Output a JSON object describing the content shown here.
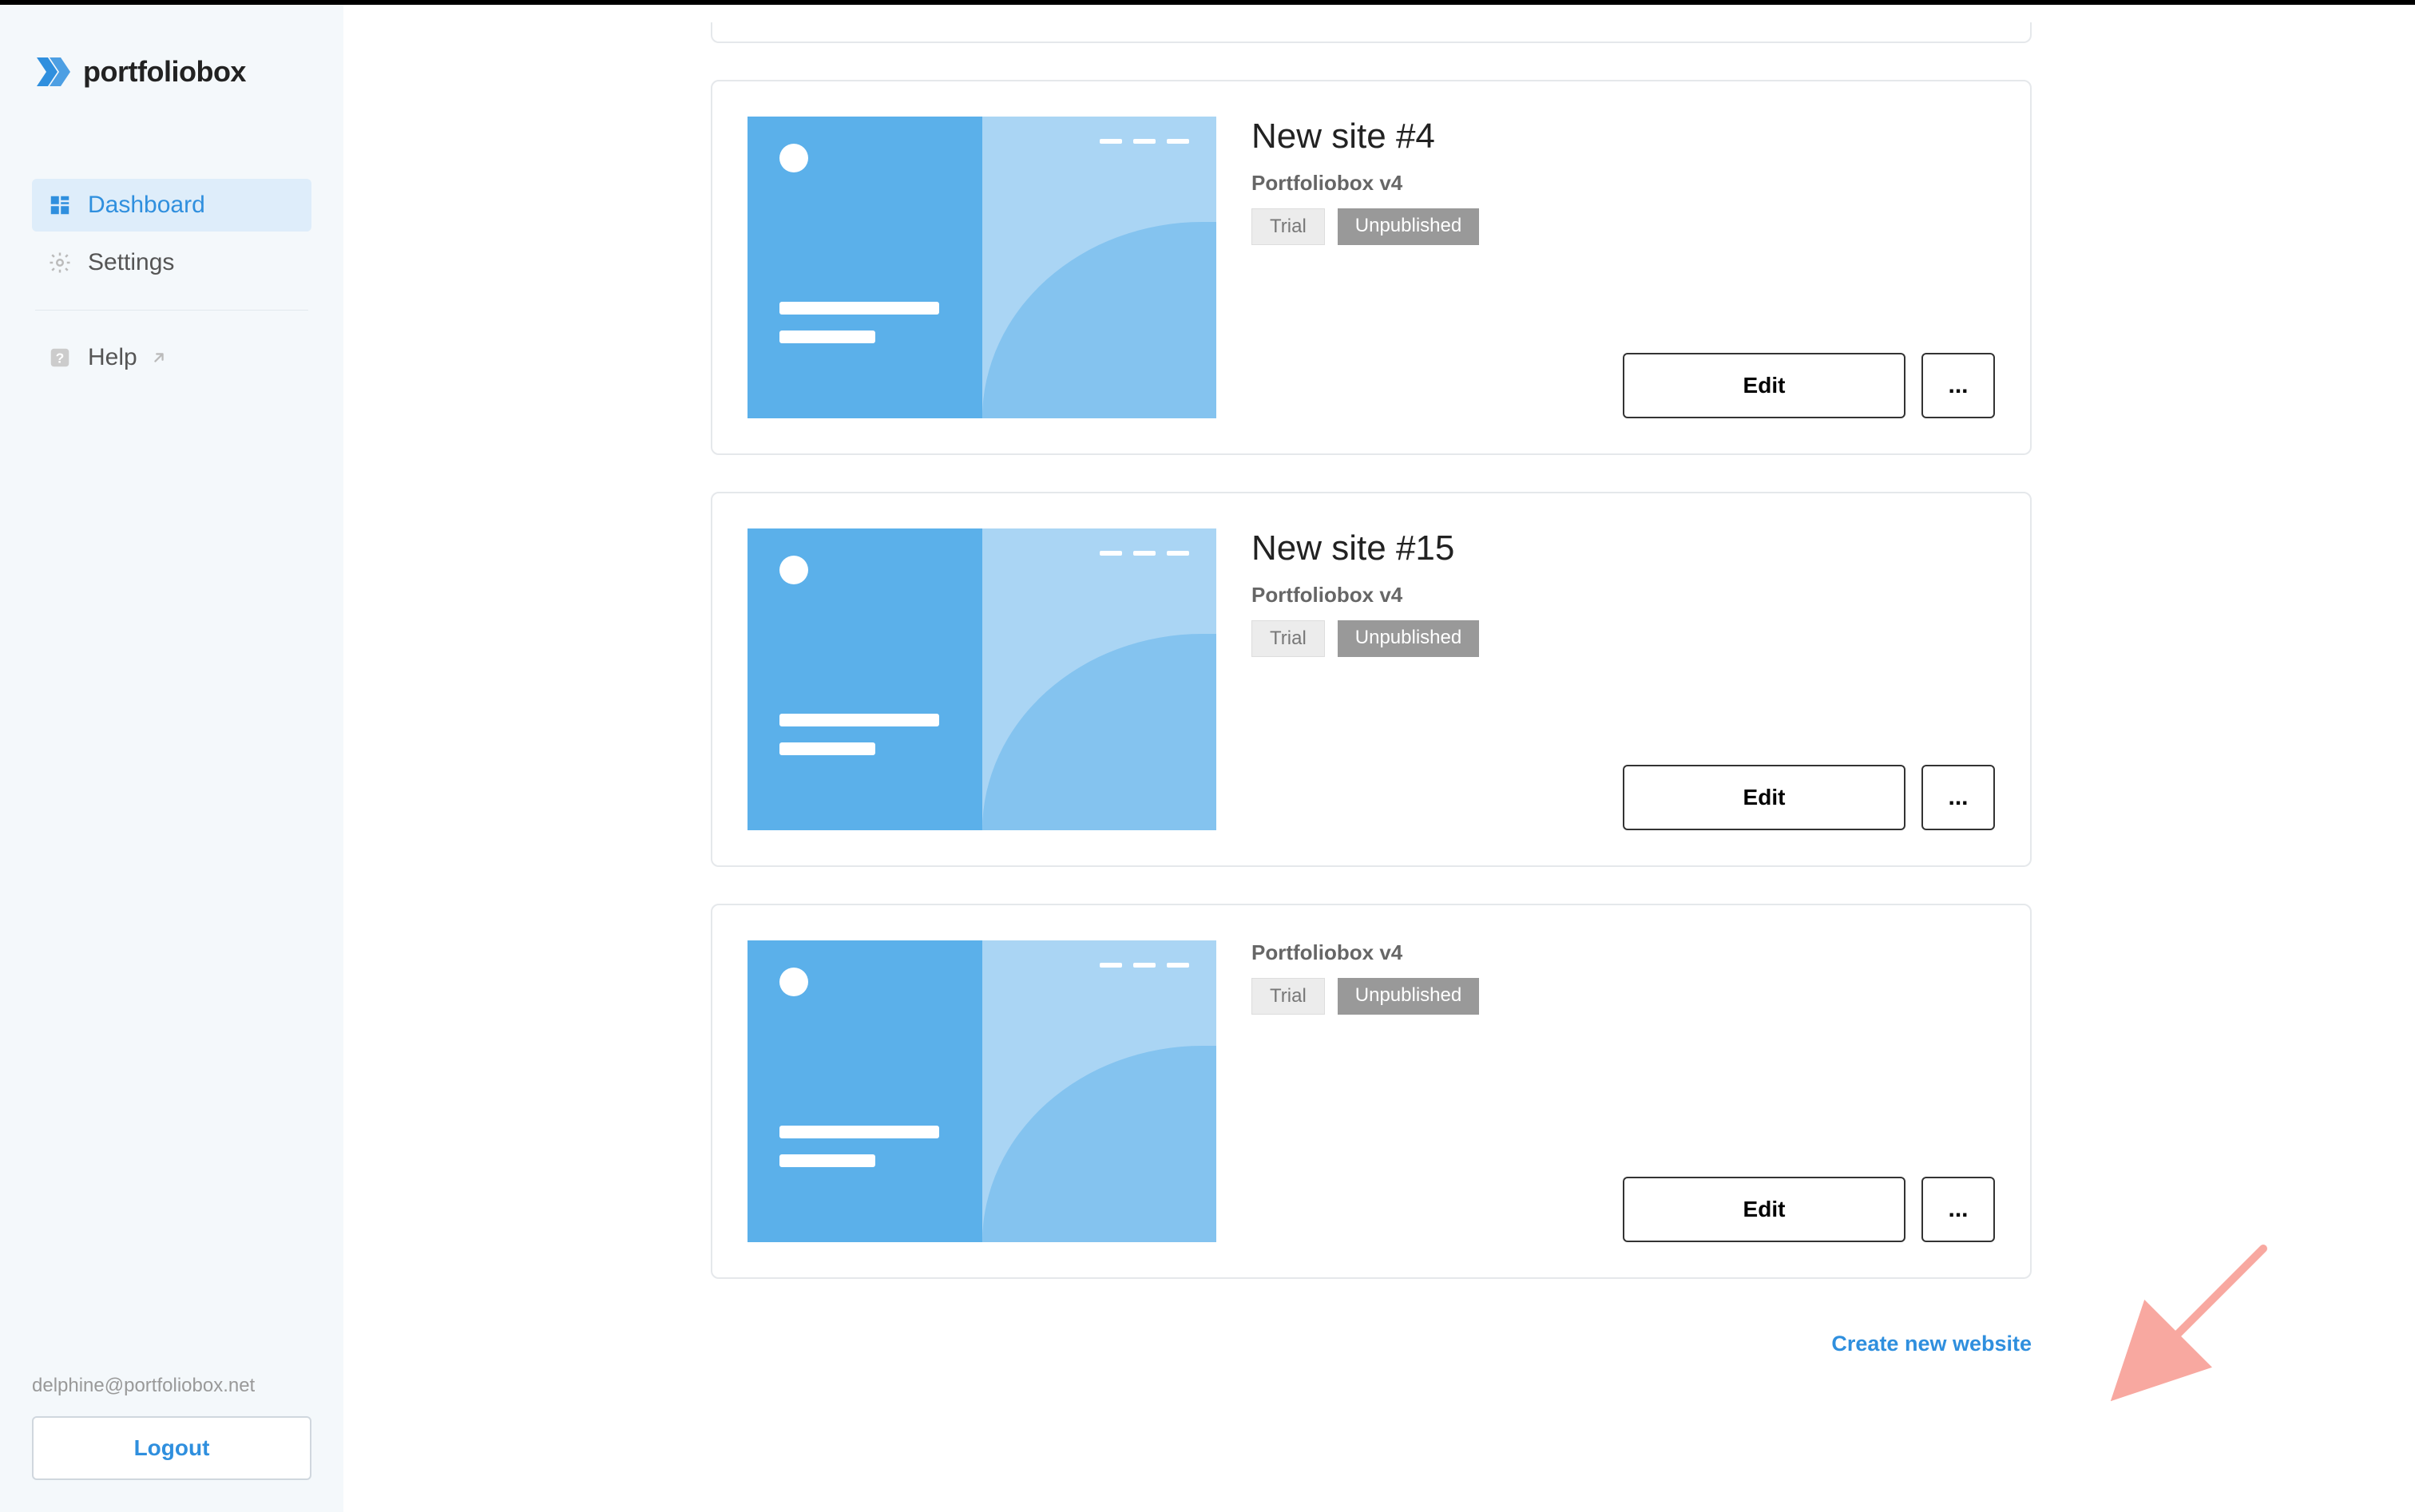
{
  "brand": {
    "name": "portfoliobox"
  },
  "sidebar": {
    "nav": {
      "dashboard": "Dashboard",
      "settings": "Settings",
      "help": "Help"
    },
    "user_email": "delphine@portfoliobox.net",
    "logout_label": "Logout"
  },
  "sites": [
    {
      "title": "New site #4",
      "version": "Portfoliobox v4",
      "badge_trial": "Trial",
      "badge_status": "Unpublished",
      "edit_label": "Edit",
      "more_label": "..."
    },
    {
      "title": "New site #15",
      "version": "Portfoliobox v4",
      "badge_trial": "Trial",
      "badge_status": "Unpublished",
      "edit_label": "Edit",
      "more_label": "..."
    },
    {
      "title": "",
      "version": "Portfoliobox v4",
      "badge_trial": "Trial",
      "badge_status": "Unpublished",
      "edit_label": "Edit",
      "more_label": "..."
    }
  ],
  "create_new_label": "Create new website"
}
